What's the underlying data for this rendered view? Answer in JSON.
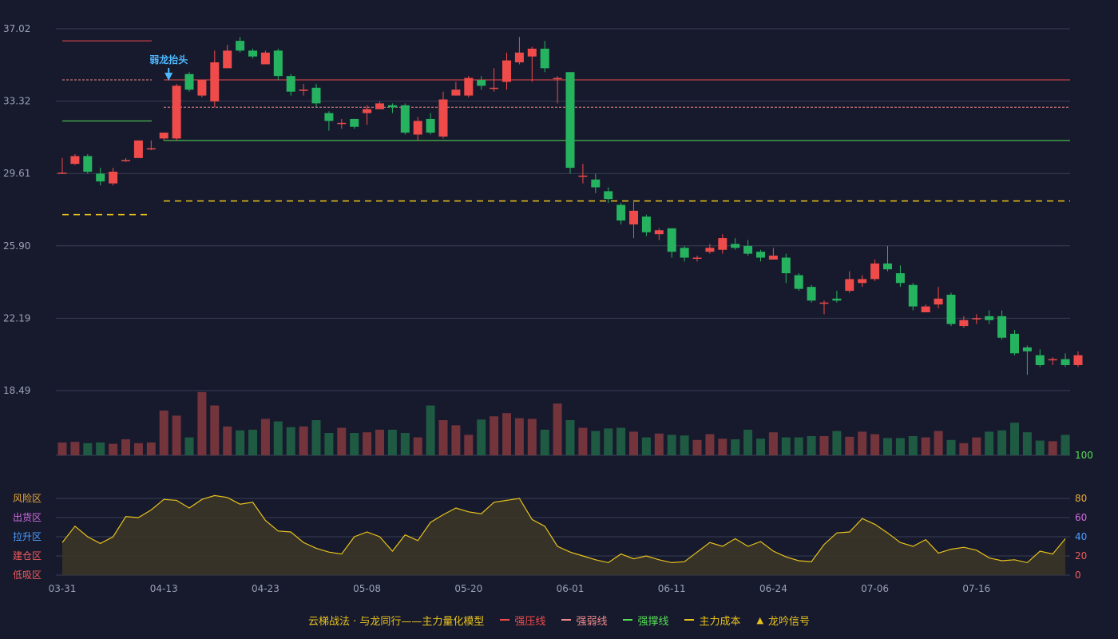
{
  "legend": {
    "model_label": "云梯战法 · 与龙同行——主力量化模型",
    "items": [
      {
        "label": "强压线",
        "color": "#ef4b4b",
        "style": "solid"
      },
      {
        "label": "强弱线",
        "color": "#f08a8a",
        "style": "dashed"
      },
      {
        "label": "强撑线",
        "color": "#55dd55",
        "style": "solid"
      },
      {
        "label": "主力成本",
        "color": "#e8c21c",
        "style": "dashed"
      },
      {
        "label": "龙吟信号",
        "color": "#e8c21c",
        "style": "triangle"
      }
    ]
  },
  "colors": {
    "up": "#ef4b4b",
    "down": "#26b35f",
    "vol_up": "#73343c",
    "vol_down": "#1f5a43",
    "grid": "#3a3f55",
    "osc_line": "#e8c21c",
    "osc_fill": "#3a3528",
    "signal": "#4db8ff"
  },
  "chart_data": {
    "type": "candlestick",
    "price_axis": {
      "min": 18.49,
      "max": 37.02,
      "ticks": [
        "37.02",
        "33.32",
        "29.61",
        "25.90",
        "22.19",
        "18.49"
      ]
    },
    "x_tick_labels": [
      {
        "index": 0,
        "label": "03-31"
      },
      {
        "index": 8,
        "label": "04-13"
      },
      {
        "index": 16,
        "label": "04-23"
      },
      {
        "index": 24,
        "label": "05-08"
      },
      {
        "index": 32,
        "label": "05-20"
      },
      {
        "index": 40,
        "label": "06-01"
      },
      {
        "index": 48,
        "label": "06-11"
      },
      {
        "index": 56,
        "label": "06-24"
      },
      {
        "index": 64,
        "label": "07-06"
      },
      {
        "index": 72,
        "label": "07-16"
      }
    ],
    "candles": [
      [
        29.65,
        29.65,
        30.4,
        29.6
      ],
      [
        30.1,
        30.5,
        30.6,
        30.05
      ],
      [
        30.5,
        29.7,
        30.6,
        29.6
      ],
      [
        29.6,
        29.2,
        29.9,
        29.0
      ],
      [
        29.1,
        29.7,
        29.9,
        29.0
      ],
      [
        30.3,
        30.3,
        30.4,
        30.2
      ],
      [
        30.4,
        31.3,
        31.3,
        30.4
      ],
      [
        30.9,
        30.9,
        31.3,
        30.8
      ],
      [
        31.4,
        31.7,
        31.7,
        31.3
      ],
      [
        31.4,
        34.1,
        34.2,
        31.3
      ],
      [
        34.7,
        33.9,
        34.8,
        33.8
      ],
      [
        33.6,
        34.4,
        34.4,
        33.5
      ],
      [
        33.3,
        35.3,
        35.9,
        33.0
      ],
      [
        35.0,
        35.9,
        36.2,
        35.0
      ],
      [
        36.4,
        35.9,
        36.6,
        35.8
      ],
      [
        35.9,
        35.6,
        36.0,
        35.5
      ],
      [
        35.2,
        35.8,
        35.9,
        35.2
      ],
      [
        35.9,
        34.6,
        36.0,
        34.4
      ],
      [
        34.6,
        33.8,
        34.7,
        33.6
      ],
      [
        33.9,
        33.9,
        34.2,
        33.6
      ],
      [
        34.0,
        33.2,
        34.2,
        33.0
      ],
      [
        32.7,
        32.3,
        32.8,
        31.8
      ],
      [
        32.2,
        32.2,
        32.4,
        31.9
      ],
      [
        32.4,
        32.0,
        32.4,
        31.9
      ],
      [
        32.7,
        32.9,
        33.1,
        32.1
      ],
      [
        32.9,
        33.2,
        33.3,
        32.9
      ],
      [
        33.1,
        33.0,
        33.2,
        32.7
      ],
      [
        33.1,
        31.7,
        33.2,
        31.6
      ],
      [
        31.6,
        32.3,
        32.5,
        31.3
      ],
      [
        32.4,
        31.7,
        32.7,
        31.6
      ],
      [
        31.5,
        33.4,
        33.8,
        31.4
      ],
      [
        33.6,
        33.9,
        34.3,
        33.6
      ],
      [
        33.6,
        34.5,
        34.6,
        33.5
      ],
      [
        34.4,
        34.1,
        34.6,
        33.9
      ],
      [
        34.0,
        34.0,
        35.0,
        33.8
      ],
      [
        34.3,
        35.4,
        35.8,
        33.9
      ],
      [
        35.3,
        35.8,
        36.6,
        35.2
      ],
      [
        35.6,
        36.0,
        36.1,
        34.3
      ],
      [
        36.0,
        35.0,
        36.4,
        34.8
      ],
      [
        34.5,
        34.5,
        34.6,
        33.2
      ],
      [
        34.8,
        29.9,
        34.8,
        29.6
      ],
      [
        29.5,
        29.5,
        30.1,
        29.1
      ],
      [
        29.3,
        28.9,
        29.6,
        28.6
      ],
      [
        28.7,
        28.3,
        28.9,
        28.1
      ],
      [
        28.0,
        27.2,
        28.1,
        27.0
      ],
      [
        27.0,
        27.7,
        28.2,
        26.3
      ],
      [
        27.4,
        26.6,
        27.5,
        26.4
      ],
      [
        26.5,
        26.7,
        26.8,
        26.2
      ],
      [
        26.8,
        25.6,
        26.8,
        25.3
      ],
      [
        25.8,
        25.3,
        25.9,
        25.1
      ],
      [
        25.3,
        25.3,
        25.4,
        25.1
      ],
      [
        25.6,
        25.8,
        26.0,
        25.5
      ],
      [
        25.7,
        26.3,
        26.5,
        25.5
      ],
      [
        26.0,
        25.8,
        26.3,
        25.7
      ],
      [
        25.9,
        25.5,
        26.2,
        25.4
      ],
      [
        25.6,
        25.3,
        25.7,
        25.1
      ],
      [
        25.2,
        25.4,
        25.8,
        25.2
      ],
      [
        25.3,
        24.5,
        25.5,
        24.0
      ],
      [
        24.4,
        23.7,
        24.5,
        23.6
      ],
      [
        23.8,
        23.1,
        23.9,
        23.0
      ],
      [
        23.0,
        23.0,
        23.1,
        22.4
      ],
      [
        23.2,
        23.1,
        23.6,
        23.0
      ],
      [
        23.6,
        24.2,
        24.6,
        23.5
      ],
      [
        24.0,
        24.2,
        24.4,
        23.8
      ],
      [
        24.2,
        25.0,
        25.2,
        24.1
      ],
      [
        25.0,
        24.7,
        25.9,
        24.6
      ],
      [
        24.5,
        24.0,
        24.9,
        23.8
      ],
      [
        23.9,
        22.8,
        24.0,
        22.6
      ],
      [
        22.5,
        22.8,
        22.9,
        22.5
      ],
      [
        22.9,
        23.2,
        23.8,
        22.7
      ],
      [
        23.4,
        21.9,
        23.5,
        21.8
      ],
      [
        21.8,
        22.1,
        22.3,
        21.7
      ],
      [
        22.2,
        22.2,
        22.4,
        21.9
      ],
      [
        22.3,
        22.1,
        22.6,
        21.9
      ],
      [
        22.3,
        21.2,
        22.6,
        21.1
      ],
      [
        21.4,
        20.4,
        21.6,
        20.3
      ],
      [
        20.7,
        20.5,
        20.8,
        19.3
      ],
      [
        20.3,
        19.8,
        20.6,
        19.7
      ],
      [
        20.1,
        20.1,
        20.2,
        19.8
      ],
      [
        20.1,
        19.8,
        20.4,
        19.7
      ],
      [
        19.8,
        20.3,
        20.5,
        19.7
      ]
    ],
    "volume_rel": [
      0.2,
      0.21,
      0.19,
      0.2,
      0.18,
      0.25,
      0.19,
      0.2,
      0.7,
      0.62,
      0.28,
      0.99,
      0.78,
      0.45,
      0.39,
      0.4,
      0.57,
      0.53,
      0.44,
      0.45,
      0.55,
      0.35,
      0.43,
      0.35,
      0.36,
      0.4,
      0.4,
      0.35,
      0.28,
      0.78,
      0.55,
      0.47,
      0.32,
      0.56,
      0.61,
      0.66,
      0.58,
      0.57,
      0.4,
      0.81,
      0.55,
      0.43,
      0.38,
      0.42,
      0.43,
      0.37,
      0.28,
      0.34,
      0.32,
      0.31,
      0.24,
      0.33,
      0.26,
      0.25,
      0.4,
      0.26,
      0.36,
      0.28,
      0.28,
      0.3,
      0.3,
      0.38,
      0.29,
      0.37,
      0.33,
      0.27,
      0.27,
      0.3,
      0.28,
      0.38,
      0.24,
      0.19,
      0.28,
      0.37,
      0.39,
      0.51,
      0.36,
      0.23,
      0.22,
      0.32
    ],
    "oscillator": {
      "axis": {
        "min": 0,
        "max": 100,
        "ticks": [
          "100",
          "80",
          "60",
          "40",
          "20",
          "0"
        ]
      },
      "zones": [
        {
          "label": "风险区",
          "color": "#e8a93a"
        },
        {
          "label": "出货区",
          "color": "#d06be0"
        },
        {
          "label": "拉升区",
          "color": "#4d9fff"
        },
        {
          "label": "建仓区",
          "color": "#ef5b5b"
        },
        {
          "label": "低吸区",
          "color": "#ef5b5b"
        }
      ],
      "values": [
        34,
        51,
        40,
        33,
        40,
        61,
        60,
        68,
        79,
        78,
        70,
        79,
        83,
        81,
        74,
        76,
        57,
        46,
        45,
        34,
        28,
        24,
        22,
        40,
        45,
        40,
        25,
        42,
        36,
        55,
        63,
        70,
        66,
        64,
        76,
        78,
        80,
        58,
        51,
        30,
        24,
        20,
        16,
        13,
        22,
        17,
        20,
        16,
        13,
        14,
        24,
        34,
        30,
        38,
        30,
        35,
        25,
        19,
        15,
        14,
        32,
        44,
        45,
        59,
        53,
        44,
        34,
        30,
        37,
        23,
        27,
        29,
        26,
        18,
        15,
        16,
        13,
        25,
        22,
        38
      ]
    },
    "annotations": [
      {
        "type": "signal",
        "index": 8,
        "label": "弱龙抬头"
      }
    ]
  }
}
